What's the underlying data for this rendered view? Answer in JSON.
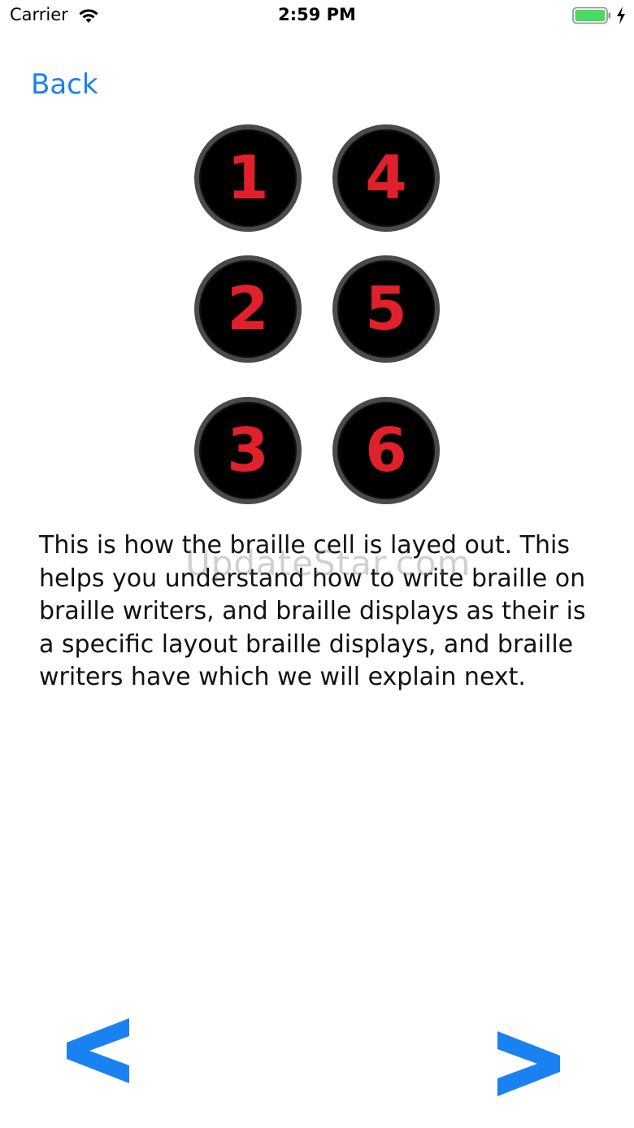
{
  "status_bar": {
    "carrier": "Carrier",
    "time": "2:59 PM",
    "icons": [
      "wifi-icon",
      "battery-icon",
      "charging-icon"
    ],
    "battery_color": "#4cd964"
  },
  "navigation": {
    "back_label": "Back",
    "accent_color": "#1a82f0",
    "prev_label": "<",
    "next_label": ">"
  },
  "braille_cell": {
    "dots": [
      {
        "number": "1"
      },
      {
        "number": "2"
      },
      {
        "number": "3"
      },
      {
        "number": "4"
      },
      {
        "number": "5"
      },
      {
        "number": "6"
      }
    ],
    "digit_color": "#e0202a"
  },
  "description": "This is how the braille cell is layed out. This helps you understand how to write braille on braille writers, and braille displays as their is a specific layout braille displays, and braille writers have which we will explain next.",
  "watermark": "UpdateStar.com"
}
